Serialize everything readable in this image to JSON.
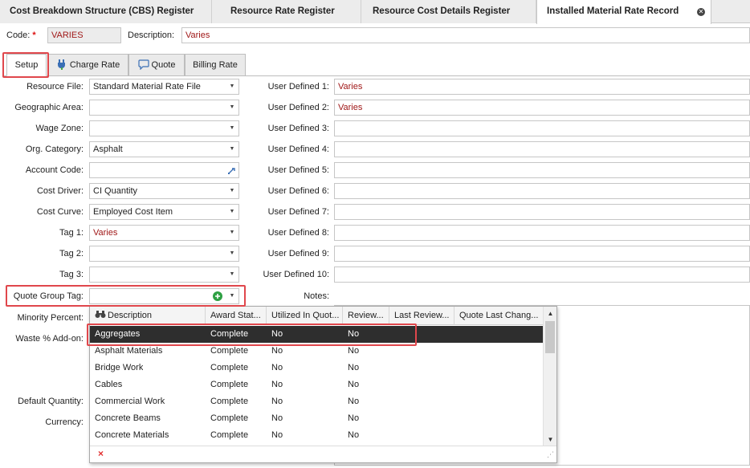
{
  "doc_tabs": [
    "Cost Breakdown Structure (CBS) Register",
    "Resource Rate Register",
    "Resource Cost Details Register",
    "Installed Material Rate Record"
  ],
  "code": {
    "label": "Code:",
    "value": "VARIES"
  },
  "description": {
    "label": "Description:",
    "value": "Varies"
  },
  "sub_tabs": [
    "Setup",
    "Charge Rate",
    "Quote",
    "Billing Rate"
  ],
  "left_fields": [
    {
      "label": "Resource File:",
      "value": "Standard Material Rate File"
    },
    {
      "label": "Geographic Area:",
      "value": ""
    },
    {
      "label": "Wage Zone:",
      "value": ""
    },
    {
      "label": "Org. Category:",
      "value": "Asphalt"
    },
    {
      "label": "Account Code:",
      "value": ""
    },
    {
      "label": "Cost Driver:",
      "value": "CI Quantity"
    },
    {
      "label": "Cost Curve:",
      "value": "Employed Cost Item"
    },
    {
      "label": "Tag 1:",
      "value": "Varies"
    },
    {
      "label": "Tag 2:",
      "value": ""
    },
    {
      "label": "Tag 3:",
      "value": ""
    }
  ],
  "right_fields": [
    {
      "label": "User Defined 1:",
      "value": "Varies"
    },
    {
      "label": "User Defined 2:",
      "value": "Varies"
    },
    {
      "label": "User Defined 3:",
      "value": ""
    },
    {
      "label": "User Defined 4:",
      "value": ""
    },
    {
      "label": "User Defined 5:",
      "value": ""
    },
    {
      "label": "User Defined 6:",
      "value": ""
    },
    {
      "label": "User Defined 7:",
      "value": ""
    },
    {
      "label": "User Defined 8:",
      "value": ""
    },
    {
      "label": "User Defined 9:",
      "value": ""
    },
    {
      "label": "User Defined 10:",
      "value": ""
    }
  ],
  "quote_group_tag": {
    "label": "Quote Group Tag:",
    "value": ""
  },
  "notes_label": "Notes:",
  "lower_labels": {
    "minority": "Minority Percent:",
    "waste": "Waste % Add-on:",
    "default_qty": "Default Quantity:",
    "currency": "Currency:"
  },
  "dropdown": {
    "columns": [
      "Description",
      "Award Stat...",
      "Utilized In Quot...",
      "Review...",
      "Last Review...",
      "Quote Last Chang..."
    ],
    "rows": [
      [
        "Aggregates",
        "Complete",
        "No",
        "No"
      ],
      [
        "Asphalt Materials",
        "Complete",
        "No",
        "No"
      ],
      [
        "Bridge Work",
        "Complete",
        "No",
        "No"
      ],
      [
        "Cables",
        "Complete",
        "No",
        "No"
      ],
      [
        "Commercial Work",
        "Complete",
        "No",
        "No"
      ],
      [
        "Concrete Beams",
        "Complete",
        "No",
        "No"
      ],
      [
        "Concrete Materials",
        "Complete",
        "No",
        "No"
      ]
    ],
    "selected_index": 0
  },
  "colors": {
    "required": "#dd1111",
    "value_red": "#a01818",
    "highlight": "#e0474c",
    "selected_row": "#2e2e2e",
    "add_green": "#2ea043"
  }
}
